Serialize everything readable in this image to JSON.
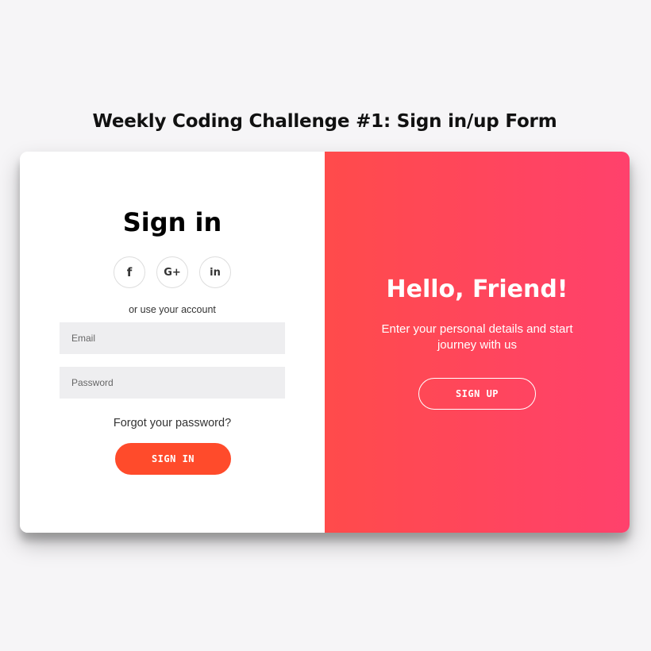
{
  "page": {
    "title": "Weekly Coding Challenge #1: Sign in/up Form"
  },
  "signin": {
    "title": "Sign in",
    "socials": [
      {
        "label": "f",
        "icon": "facebook-icon"
      },
      {
        "label": "G+",
        "icon": "google-plus-icon"
      },
      {
        "label": "in",
        "icon": "linkedin-icon"
      }
    ],
    "alt_text": "or use your account",
    "email_placeholder": "Email",
    "password_placeholder": "Password",
    "forgot_label": "Forgot your password?",
    "button_label": "SIGN IN"
  },
  "overlay": {
    "title": "Hello, Friend!",
    "text": "Enter your personal details and start journey with us",
    "button_label": "SIGN UP"
  },
  "colors": {
    "accent": "#ff4b2b",
    "gradient_start": "#ff4b4b",
    "gradient_end": "#ff416c",
    "background": "#f6f5f7",
    "input_background": "#eeeef0"
  }
}
